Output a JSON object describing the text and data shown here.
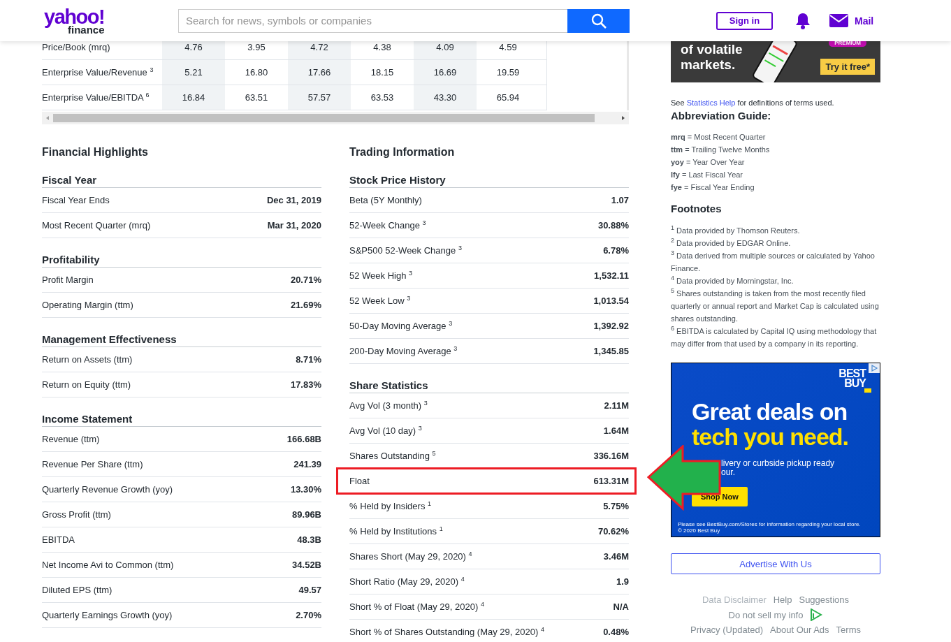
{
  "header": {
    "logo": {
      "brand": "yahoo!",
      "product": "finance"
    },
    "search": {
      "placeholder": "Search for news, symbols or companies"
    },
    "sign_in": "Sign in",
    "mail": "Mail"
  },
  "valuation_table": {
    "rows": [
      {
        "label": "Price/Book (mrq)",
        "values": [
          "4.76",
          "3.95",
          "4.72",
          "4.38",
          "4.09",
          "4.59"
        ]
      },
      {
        "label": "Enterprise Value/Revenue $^{3}$",
        "values": [
          "5.21",
          "16.80",
          "17.66",
          "18.15",
          "16.69",
          "19.59"
        ]
      },
      {
        "label": "Enterprise Value/EBITDA $^{6}$",
        "values": [
          "16.84",
          "63.51",
          "57.57",
          "63.53",
          "43.30",
          "65.94"
        ]
      }
    ]
  },
  "financial_highlights": {
    "title": "Financial Highlights",
    "sections": [
      {
        "title": "Fiscal Year",
        "rows": [
          {
            "label": "Fiscal Year Ends",
            "value": "Dec 31, 2019"
          },
          {
            "label": "Most Recent Quarter (mrq)",
            "value": "Mar 31, 2020"
          }
        ]
      },
      {
        "title": "Profitability",
        "rows": [
          {
            "label": "Profit Margin",
            "value": "20.71%"
          },
          {
            "label": "Operating Margin (ttm)",
            "value": "21.69%"
          }
        ]
      },
      {
        "title": "Management Effectiveness",
        "rows": [
          {
            "label": "Return on Assets (ttm)",
            "value": "8.71%"
          },
          {
            "label": "Return on Equity (ttm)",
            "value": "17.83%"
          }
        ]
      },
      {
        "title": "Income Statement",
        "rows": [
          {
            "label": "Revenue (ttm)",
            "value": "166.68B"
          },
          {
            "label": "Revenue Per Share (ttm)",
            "value": "241.39"
          },
          {
            "label": "Quarterly Revenue Growth (yoy)",
            "value": "13.30%"
          },
          {
            "label": "Gross Profit (ttm)",
            "value": "89.96B"
          },
          {
            "label": "EBITDA",
            "value": "48.3B"
          },
          {
            "label": "Net Income Avi to Common (ttm)",
            "value": "34.52B"
          },
          {
            "label": "Diluted EPS (ttm)",
            "value": "49.57"
          },
          {
            "label": "Quarterly Earnings Growth (yoy)",
            "value": "2.70%"
          }
        ]
      }
    ]
  },
  "trading_information": {
    "title": "Trading Information",
    "sections": [
      {
        "title": "Stock Price History",
        "rows": [
          {
            "label": "Beta (5Y Monthly)",
            "value": "1.07",
            "highlighted": false
          },
          {
            "label": "52-Week Change $^{3}$",
            "value": "30.88%",
            "highlighted": false
          },
          {
            "label": "S&P500 52-Week Change $^{3}$",
            "value": "6.78%",
            "highlighted": false
          },
          {
            "label": "52 Week High $^{3}$",
            "value": "1,532.11",
            "highlighted": false
          },
          {
            "label": "52 Week Low $^{3}$",
            "value": "1,013.54",
            "highlighted": false
          },
          {
            "label": "50-Day Moving Average $^{3}$",
            "value": "1,392.92",
            "highlighted": false
          },
          {
            "label": "200-Day Moving Average $^{3}$",
            "value": "1,345.85",
            "highlighted": false
          }
        ]
      },
      {
        "title": "Share Statistics",
        "rows": [
          {
            "label": "Avg Vol (3 month) $^{3}$",
            "value": "2.11M",
            "highlighted": false
          },
          {
            "label": "Avg Vol (10 day) $^{3}$",
            "value": "1.64M",
            "highlighted": false
          },
          {
            "label": "Shares Outstanding $^{5}$",
            "value": "336.16M",
            "highlighted": false
          },
          {
            "label": "Float",
            "value": "613.31M",
            "highlighted": true
          },
          {
            "label": "% Held by Insiders $^{1}$",
            "value": "5.75%",
            "highlighted": false
          },
          {
            "label": "% Held by Institutions $^{1}$",
            "value": "70.62%",
            "highlighted": false
          },
          {
            "label": "Shares Short (May 29, 2020) $^{4}$",
            "value": "3.46M",
            "highlighted": false
          },
          {
            "label": "Short Ratio (May 29, 2020) $^{4}$",
            "value": "1.9",
            "highlighted": false
          },
          {
            "label": "Short % of Float (May 29, 2020) $^{4}$",
            "value": "N/A",
            "highlighted": false
          },
          {
            "label": "Short % of Shares Outstanding (May 29, 2020) $^{4}$",
            "value": "0.48%",
            "highlighted": false
          }
        ]
      }
    ]
  },
  "sidebar": {
    "promo": {
      "headline": [
        "of volatile",
        "markets."
      ],
      "badge": "PREMIUM",
      "button": "Try it free*"
    },
    "help_note": {
      "before": "See ",
      "link": "Statistics Help",
      "after": " for definitions of terms used."
    },
    "abbreviation_title": "Abbreviation Guide:",
    "abbreviations": [
      "**mrq** = Most Recent Quarter",
      "**ttm** = Trailing Twelve Months",
      "**yoy** = Year Over Year",
      "**lfy** = Last Fiscal Year",
      "**fye** = Fiscal Year Ending"
    ],
    "footnotes_title": "Footnotes",
    "footnotes": [
      "$^{1}$ Data provided by Thomson Reuters.",
      "$^{2}$ Data provided by EDGAR Online.",
      "$^{3}$ Data derived from multiple sources or calculated by Yahoo Finance.",
      "$^{4}$ Data provided by Morningstar, Inc.",
      "$^{5}$ Shares outstanding is taken from the most recently filed quarterly or annual report and Market Cap is calculated using shares outstanding.",
      "$^{6}$ EBITDA is calculated by Capital IQ using methodology that may differ from that used by a company in its reporting."
    ],
    "ad": {
      "logo": [
        "BEST",
        "BUY"
      ],
      "headline": "Great deals on",
      "headline_accent": "tech you need.",
      "subtext": [
        "livery or curbside pickup ready",
        "our."
      ],
      "button": "Shop Now",
      "fine_print": [
        "Please see BestBuy.com/Stores for information regarding your local store.",
        "© 2020 Best Buy"
      ]
    },
    "advertise": "Advertise With Us",
    "footer_links": [
      [
        "Data Disclaimer",
        "Help",
        "Suggestions"
      ],
      [
        "Do not sell my info"
      ],
      [
        "Privacy (Updated)",
        "About Our Ads",
        "Terms"
      ]
    ]
  }
}
